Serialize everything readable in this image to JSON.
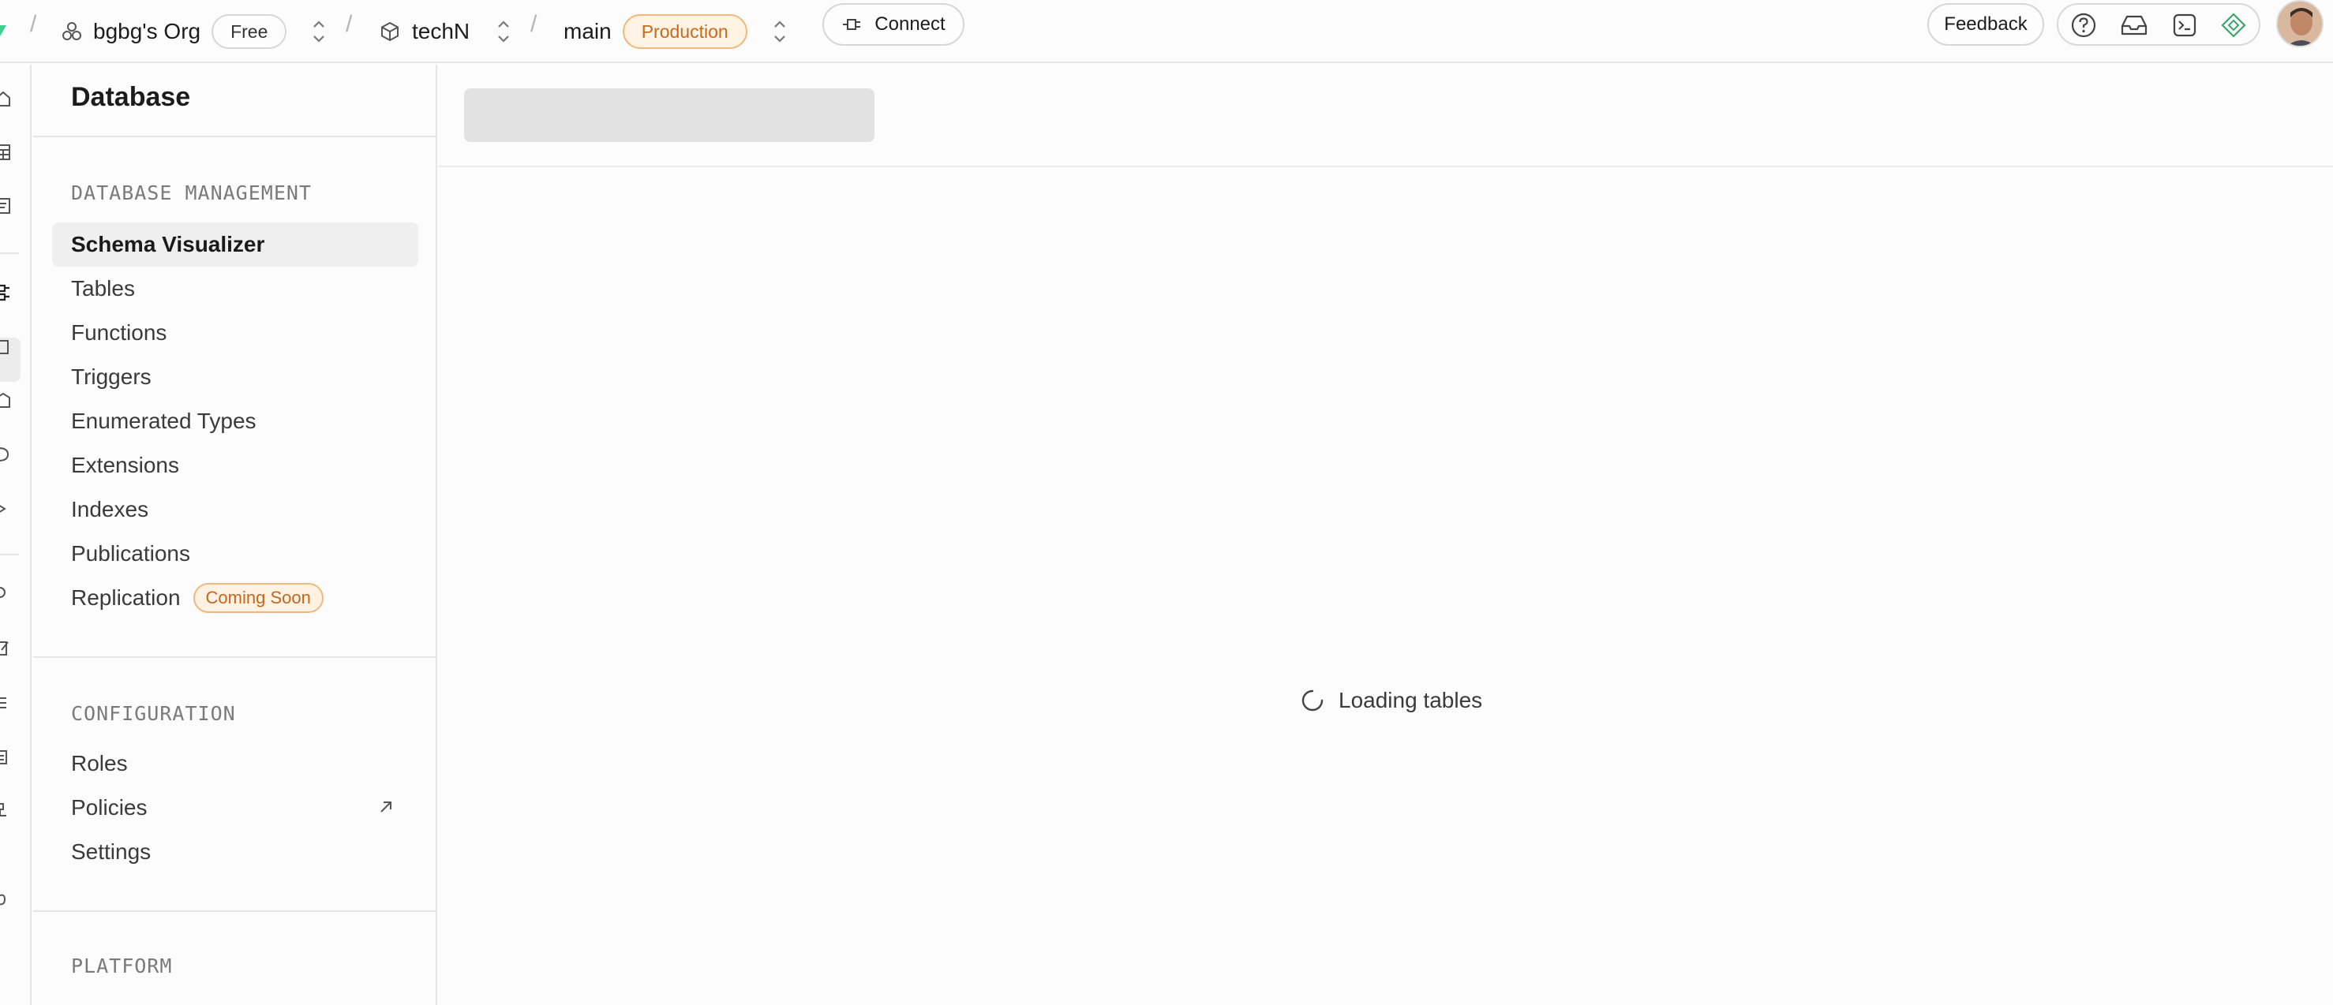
{
  "topbar": {
    "separator": "/",
    "org_name": "bgbg's Org",
    "org_plan": "Free",
    "project_name": "techN",
    "branch_name": "main",
    "branch_env": "Production",
    "connect_label": "Connect",
    "feedback_label": "Feedback",
    "icons": [
      "help-icon",
      "inbox-icon",
      "terminal-icon",
      "assistant-icon"
    ]
  },
  "sidebar": {
    "title": "Database",
    "sections": [
      {
        "heading": "DATABASE MANAGEMENT",
        "items": [
          {
            "label": "Schema Visualizer",
            "active": true
          },
          {
            "label": "Tables"
          },
          {
            "label": "Functions"
          },
          {
            "label": "Triggers"
          },
          {
            "label": "Enumerated Types"
          },
          {
            "label": "Extensions"
          },
          {
            "label": "Indexes"
          },
          {
            "label": "Publications"
          },
          {
            "label": "Replication",
            "badge": "Coming Soon"
          }
        ]
      },
      {
        "heading": "CONFIGURATION",
        "items": [
          {
            "label": "Roles"
          },
          {
            "label": "Policies",
            "external": true
          },
          {
            "label": "Settings"
          }
        ]
      },
      {
        "heading": "PLATFORM",
        "items": []
      }
    ]
  },
  "main": {
    "loading_text": "Loading tables"
  },
  "colors": {
    "brand_green": "#3ecf8e",
    "accent_orange": "#c7691f",
    "border": "#e6e6e6"
  }
}
